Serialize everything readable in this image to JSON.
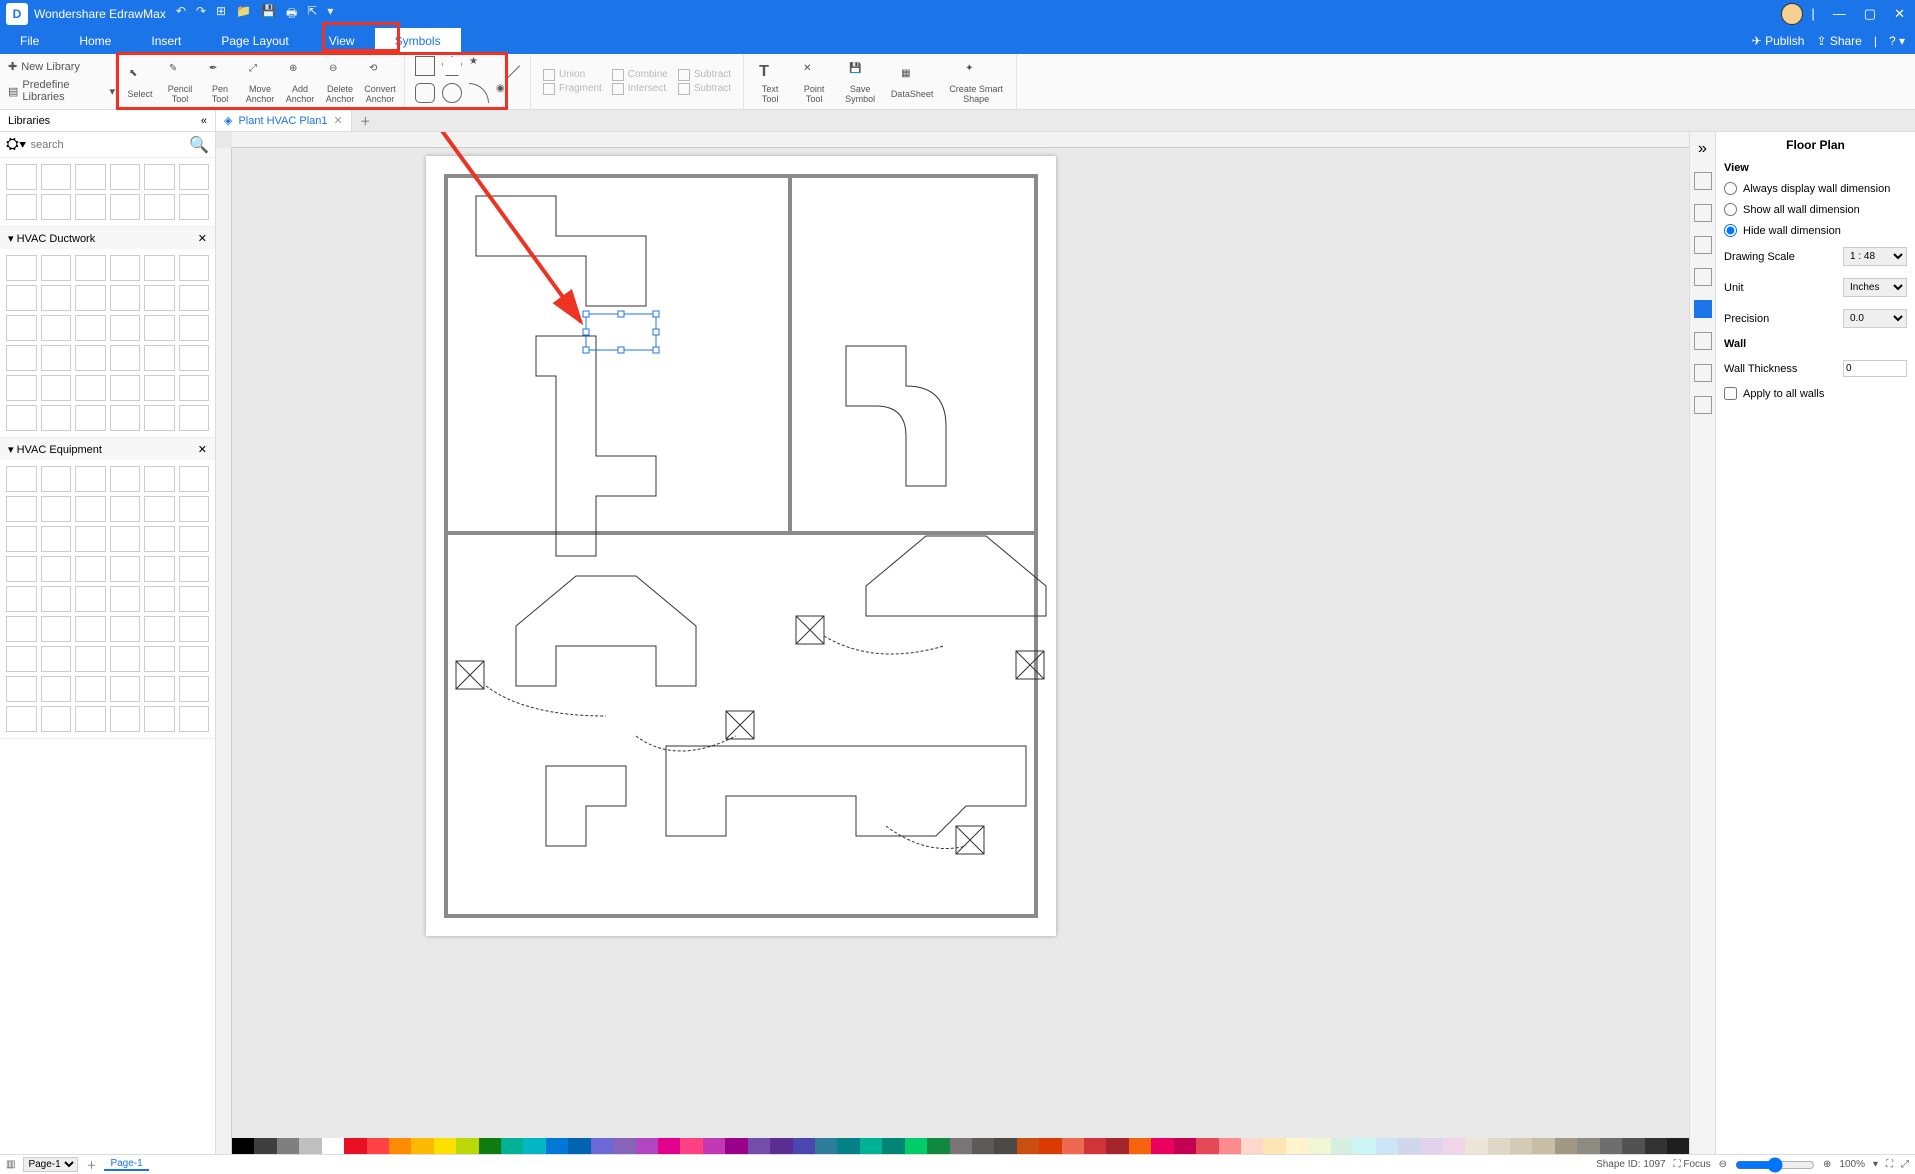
{
  "app": {
    "title": "Wondershare EdrawMax"
  },
  "titlebar_actions": {
    "publish": "Publish",
    "share": "Share"
  },
  "menubar": {
    "items": [
      "File",
      "Home",
      "Insert",
      "Page Layout",
      "View",
      "Symbols"
    ],
    "active": 5
  },
  "ribbon": {
    "new_library": "New Library",
    "predefine": "Predefine Libraries",
    "tools": [
      {
        "label": "Select"
      },
      {
        "label": "Pencil\nTool"
      },
      {
        "label": "Pen\nTool"
      },
      {
        "label": "Move\nAnchor"
      },
      {
        "label": "Add\nAnchor"
      },
      {
        "label": "Delete\nAnchor"
      },
      {
        "label": "Convert\nAnchor"
      }
    ],
    "bool_ops": [
      "Union",
      "Combine",
      "Subtract",
      "Fragment",
      "Intersect",
      "Subtract"
    ],
    "right_tools": [
      {
        "label": "Text\nTool"
      },
      {
        "label": "Point\nTool"
      },
      {
        "label": "Save\nSymbol"
      },
      {
        "label": "DataSheet"
      },
      {
        "label": "Create Smart\nShape"
      }
    ]
  },
  "libs_title": "Libraries",
  "search_placeholder": "search",
  "sections": {
    "ductwork": "HVAC Ductwork",
    "equipment": "HVAC Equipment"
  },
  "doc_tab": "Plant HVAC Plan1",
  "rightpanel": {
    "title": "Floor Plan",
    "view_title": "View",
    "opts": {
      "always": "Always display wall dimension",
      "showall": "Show all wall dimension",
      "hide": "Hide wall dimension"
    },
    "selected_view": "hide",
    "scale_label": "Drawing Scale",
    "scale_value": "1 : 48",
    "unit_label": "Unit",
    "unit_value": "Inches",
    "precision_label": "Precision",
    "precision_value": "0.0",
    "wall_title": "Wall",
    "thickness_label": "Wall Thickness",
    "thickness_value": "0",
    "apply_all": "Apply to all walls"
  },
  "statusbar": {
    "page_selector": "Page-1",
    "page_tab": "Page-1",
    "shape_id_label": "Shape ID:",
    "shape_id_value": "1097",
    "focus": "Focus",
    "zoom": "100%"
  },
  "colorbar": [
    "#000000",
    "#3f3f3f",
    "#7f7f7f",
    "#bfbfbf",
    "#ffffff",
    "#e81123",
    "#ff4343",
    "#ff8c00",
    "#ffb900",
    "#fce100",
    "#bad80a",
    "#107c10",
    "#00b294",
    "#00b7c3",
    "#0078d7",
    "#0063b1",
    "#6b69d6",
    "#8764b8",
    "#b146c2",
    "#e3008c",
    "#ff4081",
    "#c239b3",
    "#9a0089",
    "#744da9",
    "#5c2d91",
    "#4a48b0",
    "#2d7d9a",
    "#038387",
    "#00b294",
    "#018574",
    "#00cc6a",
    "#10893e",
    "#7a7574",
    "#5d5a58",
    "#4c4a48",
    "#ca5010",
    "#da3b01",
    "#ef6950",
    "#d13438",
    "#a4262c",
    "#f7630c",
    "#ea005e",
    "#c30052",
    "#e74856",
    "#ff8c8c",
    "#ffd8cc",
    "#ffe5b3",
    "#fff4ce",
    "#f2f7d3",
    "#d5f0e3",
    "#ccf5f5",
    "#cce4f7",
    "#d0d7ed",
    "#e1d3ec",
    "#f0d4e7",
    "#ece6d8",
    "#e0d8c7",
    "#d4cab6",
    "#c8bda5",
    "#a19983",
    "#8e8b82",
    "#6e6e6e",
    "#525252",
    "#333333",
    "#1f1f1f"
  ]
}
